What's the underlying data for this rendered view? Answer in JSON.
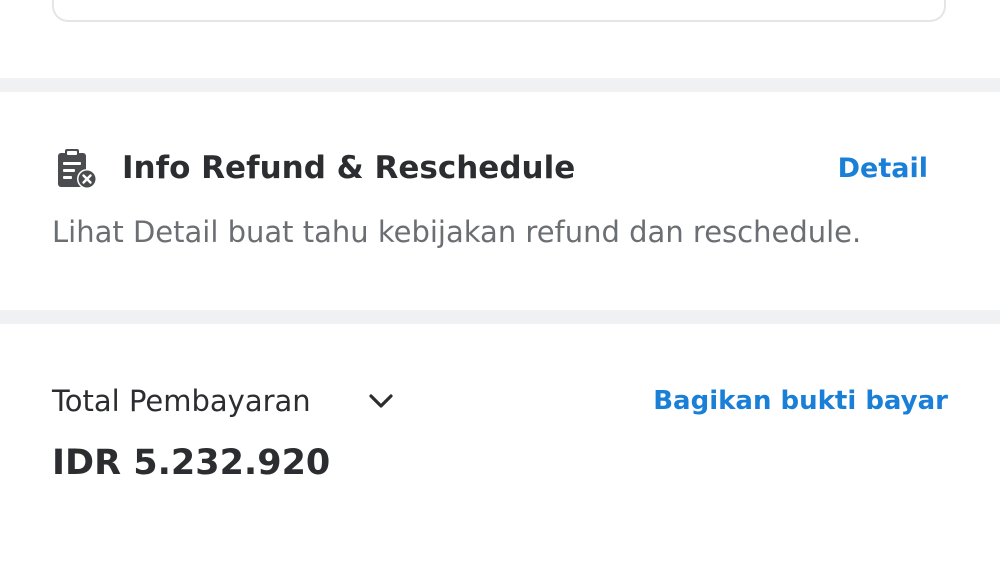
{
  "refund_info": {
    "title": "Info Refund & Reschedule",
    "detail_link": "Detail",
    "description": "Lihat Detail buat tahu kebijakan refund dan reschedule.",
    "icon": "clipboard-cancel-icon"
  },
  "payment": {
    "label": "Total Pembayaran",
    "amount": "IDR 5.232.920",
    "share_link": "Bagikan bukti bayar",
    "expand_icon": "chevron-down-icon"
  },
  "colors": {
    "accent": "#1a7fd7",
    "text_primary": "#2c2d30",
    "text_secondary": "#6b6e73",
    "divider": "#f0f1f3"
  }
}
